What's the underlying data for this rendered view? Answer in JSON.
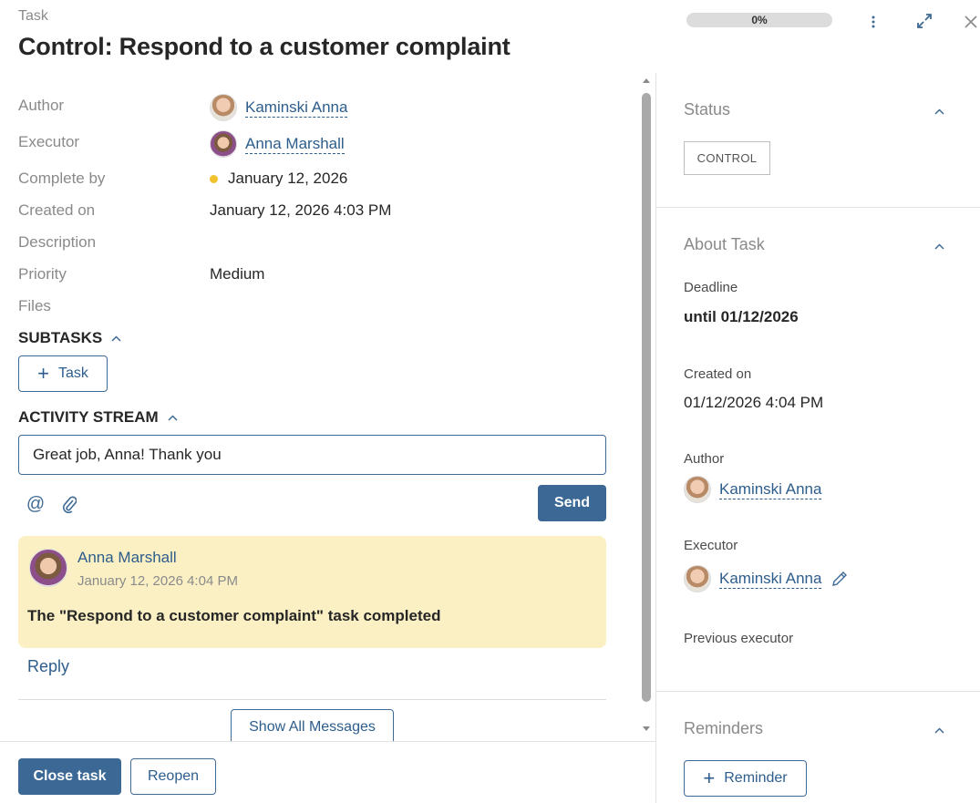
{
  "header": {
    "breadcrumb": "Task",
    "title": "Control: Respond to a customer complaint",
    "progress": "0%"
  },
  "fields": {
    "author_label": "Author",
    "author_value": "Kaminski Anna",
    "executor_label": "Executor",
    "executor_value": "Anna Marshall",
    "complete_by_label": "Complete by",
    "complete_by_value": "January 12, 2026",
    "created_on_label": "Created on",
    "created_on_value": "January 12, 2026 4:03 PM",
    "description_label": "Description",
    "priority_label": "Priority",
    "priority_value": "Medium",
    "files_label": "Files"
  },
  "subtasks": {
    "heading": "SUBTASKS",
    "add_button": "Task"
  },
  "activity": {
    "heading": "ACTIVITY STREAM",
    "input_value": "Great job, Anna! Thank you",
    "send_button": "Send",
    "message": {
      "author": "Anna Marshall",
      "time": "January 12, 2026 4:04 PM",
      "text": "The \"Respond to a customer complaint\" task completed"
    },
    "reply": "Reply",
    "show_all": "Show All Messages"
  },
  "footer": {
    "close_task": "Close task",
    "reopen": "Reopen"
  },
  "sidebar": {
    "status_title": "Status",
    "status_badge": "CONTROL",
    "about_title": "About Task",
    "deadline_label": "Deadline",
    "deadline_value": "until 01/12/2026",
    "created_label": "Created on",
    "created_value": "01/12/2026 4:04 PM",
    "author_label": "Author",
    "author_value": "Kaminski Anna",
    "executor_label": "Executor",
    "executor_value": "Kaminski Anna",
    "previous_executor_label": "Previous executor",
    "reminders_title": "Reminders",
    "reminder_button": "Reminder"
  },
  "colors": {
    "accent": "#3b6894",
    "message_bg": "#fbf0c4",
    "deadline_dot": "#f2c12e"
  }
}
